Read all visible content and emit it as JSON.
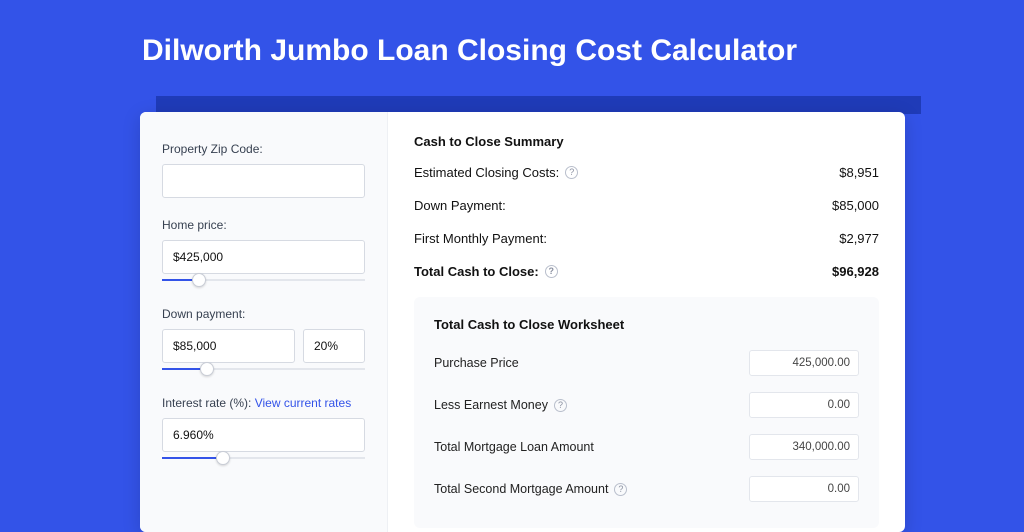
{
  "header": {
    "title": "Dilworth Jumbo Loan Closing Cost Calculator"
  },
  "sidebar": {
    "zip": {
      "label": "Property Zip Code:",
      "value": ""
    },
    "home_price": {
      "label": "Home price:",
      "value": "$425,000",
      "slider_pct": 18
    },
    "down_payment": {
      "label": "Down payment:",
      "value": "$85,000",
      "pct_value": "20%",
      "slider_pct": 22
    },
    "interest_rate": {
      "label_prefix": "Interest rate (%): ",
      "link_text": "View current rates",
      "value": "6.960%",
      "slider_pct": 30
    }
  },
  "summary": {
    "title": "Cash to Close Summary",
    "rows": [
      {
        "label": "Estimated Closing Costs:",
        "help": true,
        "value": "$8,951",
        "bold": false
      },
      {
        "label": "Down Payment:",
        "help": false,
        "value": "$85,000",
        "bold": false
      },
      {
        "label": "First Monthly Payment:",
        "help": false,
        "value": "$2,977",
        "bold": false
      },
      {
        "label": "Total Cash to Close:",
        "help": true,
        "value": "$96,928",
        "bold": true
      }
    ]
  },
  "worksheet": {
    "title": "Total Cash to Close Worksheet",
    "rows": [
      {
        "label": "Purchase Price",
        "help": false,
        "value": "425,000.00"
      },
      {
        "label": "Less Earnest Money",
        "help": true,
        "value": "0.00"
      },
      {
        "label": "Total Mortgage Loan Amount",
        "help": false,
        "value": "340,000.00"
      },
      {
        "label": "Total Second Mortgage Amount",
        "help": true,
        "value": "0.00"
      }
    ]
  }
}
